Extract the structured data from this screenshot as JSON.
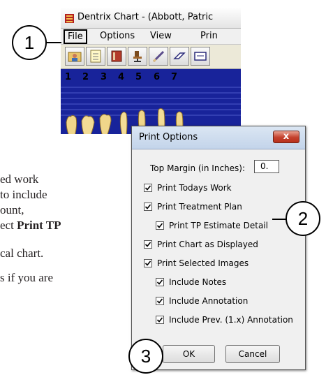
{
  "dentrix": {
    "title": "Dentrix Chart - (Abbott, Patric",
    "menus": [
      "File",
      "Options",
      "View",
      "Prin"
    ],
    "tooth_numbers": [
      "1",
      "2",
      "3",
      "4",
      "5",
      "6",
      "7"
    ]
  },
  "dialog": {
    "title": "Print Options",
    "close_label": "x",
    "top_margin_label": "Top Margin (in Inches):",
    "top_margin_value": "0.",
    "options": [
      {
        "label": "Print Todays Work",
        "checked": true
      },
      {
        "label": "Print Treatment Plan",
        "checked": true
      },
      {
        "label": "Print TP Estimate Detail",
        "checked": true
      },
      {
        "label": "Print Chart as Displayed",
        "checked": true
      },
      {
        "label": "Print Selected Images",
        "checked": true
      },
      {
        "label": "Include Notes",
        "checked": true
      },
      {
        "label": "Include Annotation",
        "checked": true
      },
      {
        "label": "Include Prev. (1.x) Annotation",
        "checked": true
      }
    ],
    "ok_label": "OK",
    "cancel_label": "Cancel"
  },
  "callouts": [
    "1",
    "2",
    "3"
  ],
  "document": {
    "line1": "ed work",
    "line2": "to include",
    "line3": "ount,",
    "line4_prefix": "ect ",
    "line4_bold": "Print TP",
    "line5": "cal chart.",
    "line6": "s if you are"
  },
  "colors": {
    "chart_background": "#18239a",
    "close_button": "#c4412d",
    "dialog_title_bar": "#c3d4ea"
  }
}
